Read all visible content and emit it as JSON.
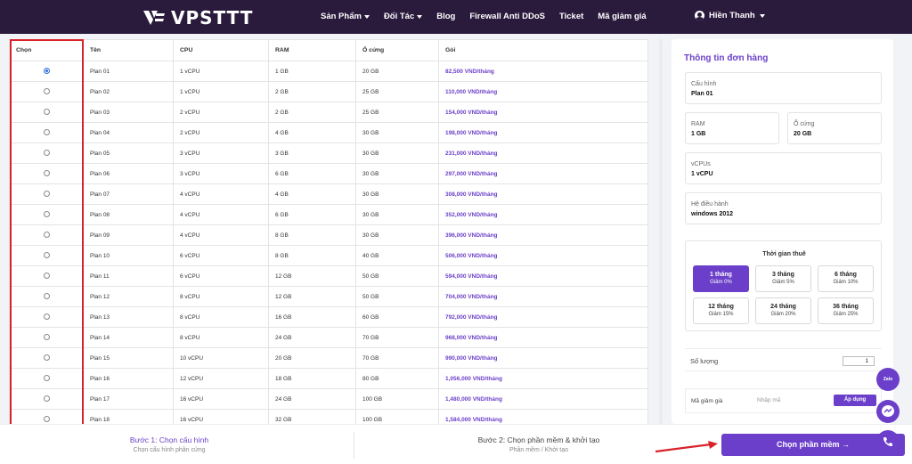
{
  "brand": {
    "name": "VPSTTT"
  },
  "nav": {
    "items": [
      {
        "label": "Sản Phẩm",
        "dropdown": true
      },
      {
        "label": "Đối Tác",
        "dropdown": true
      },
      {
        "label": "Blog",
        "dropdown": false
      },
      {
        "label": "Firewall Anti DDoS",
        "dropdown": false
      },
      {
        "label": "Ticket",
        "dropdown": false
      },
      {
        "label": "Mã giảm giá",
        "dropdown": false
      }
    ],
    "user": "Hiền Thanh"
  },
  "table": {
    "headers": [
      "Chọn",
      "Tên",
      "CPU",
      "RAM",
      "Ổ cứng",
      "Gói"
    ],
    "selected_index": 0,
    "rows": [
      {
        "name": "Plan 01",
        "cpu": "1 vCPU",
        "ram": "1 GB",
        "disk": "20 GB",
        "price": "82,500 VND/tháng"
      },
      {
        "name": "Plan 02",
        "cpu": "1 vCPU",
        "ram": "2 GB",
        "disk": "25 GB",
        "price": "110,000 VND/tháng"
      },
      {
        "name": "Plan 03",
        "cpu": "2 vCPU",
        "ram": "2 GB",
        "disk": "25 GB",
        "price": "154,000 VND/tháng"
      },
      {
        "name": "Plan 04",
        "cpu": "2 vCPU",
        "ram": "4 GB",
        "disk": "30 GB",
        "price": "198,000 VND/tháng"
      },
      {
        "name": "Plan 05",
        "cpu": "3 vCPU",
        "ram": "3 GB",
        "disk": "30 GB",
        "price": "231,000 VND/tháng"
      },
      {
        "name": "Plan 06",
        "cpu": "3 vCPU",
        "ram": "6 GB",
        "disk": "30 GB",
        "price": "297,000 VND/tháng"
      },
      {
        "name": "Plan 07",
        "cpu": "4 vCPU",
        "ram": "4 GB",
        "disk": "30 GB",
        "price": "308,000 VND/tháng"
      },
      {
        "name": "Plan 08",
        "cpu": "4 vCPU",
        "ram": "6 GB",
        "disk": "30 GB",
        "price": "352,000 VND/tháng"
      },
      {
        "name": "Plan 09",
        "cpu": "4 vCPU",
        "ram": "8 GB",
        "disk": "30 GB",
        "price": "396,000 VND/tháng"
      },
      {
        "name": "Plan 10",
        "cpu": "6 vCPU",
        "ram": "8 GB",
        "disk": "40 GB",
        "price": "506,000 VND/tháng"
      },
      {
        "name": "Plan 11",
        "cpu": "6 vCPU",
        "ram": "12 GB",
        "disk": "50 GB",
        "price": "594,000 VND/tháng"
      },
      {
        "name": "Plan 12",
        "cpu": "8 vCPU",
        "ram": "12 GB",
        "disk": "50 GB",
        "price": "704,000 VND/tháng"
      },
      {
        "name": "Plan 13",
        "cpu": "8 vCPU",
        "ram": "16 GB",
        "disk": "60 GB",
        "price": "792,000 VND/tháng"
      },
      {
        "name": "Plan 14",
        "cpu": "8 vCPU",
        "ram": "24 GB",
        "disk": "70 GB",
        "price": "968,000 VND/tháng"
      },
      {
        "name": "Plan 15",
        "cpu": "10 vCPU",
        "ram": "20 GB",
        "disk": "70 GB",
        "price": "990,000 VND/tháng"
      },
      {
        "name": "Plan 16",
        "cpu": "12 vCPU",
        "ram": "18 GB",
        "disk": "80 GB",
        "price": "1,056,000 VND/tháng"
      },
      {
        "name": "Plan 17",
        "cpu": "16 vCPU",
        "ram": "24 GB",
        "disk": "100 GB",
        "price": "1,480,000 VND/tháng"
      },
      {
        "name": "Plan 18",
        "cpu": "16 vCPU",
        "ram": "32 GB",
        "disk": "100 GB",
        "price": "1,584,000 VND/tháng"
      }
    ]
  },
  "order": {
    "title": "Thông tin đơn hàng",
    "config_label": "Cấu hình",
    "config_value": "Plan 01",
    "ram_label": "RAM",
    "ram_value": "1 GB",
    "disk_label": "Ổ cứng",
    "disk_value": "20 GB",
    "cpu_label": "vCPUs",
    "cpu_value": "1 vCPU",
    "os_label": "Hệ điều hành",
    "os_value": "windows 2012",
    "period_title": "Thời gian thuê",
    "periods": [
      {
        "label": "1 tháng",
        "discount": "Giảm 0%",
        "active": true
      },
      {
        "label": "3 tháng",
        "discount": "Giảm 5%",
        "active": false
      },
      {
        "label": "6 tháng",
        "discount": "Giảm 10%",
        "active": false
      },
      {
        "label": "12 tháng",
        "discount": "Giảm 15%",
        "active": false
      },
      {
        "label": "24 tháng",
        "discount": "Giảm 20%",
        "active": false
      },
      {
        "label": "36 tháng",
        "discount": "Giảm 25%",
        "active": false
      }
    ],
    "qty_label": "Số lượng",
    "qty_value": "1",
    "coupon_label": "Mã giảm giá",
    "coupon_placeholder": "Nhập mã",
    "coupon_button": "Áp dụng"
  },
  "steps": {
    "step1_title": "Bước 1: Chọn cấu hình",
    "step1_sub": "Chọn cấu hình phần cứng",
    "step2_title": "Bước 2: Chọn phần mềm & khởi tạo",
    "step2_sub": "Phần mềm / Khởi tạo",
    "cta_label": "Chọn phần mềm →"
  },
  "floating": {
    "zalo_label": "Zalo",
    "icons": [
      "zalo-icon",
      "messenger-icon",
      "phone-icon"
    ]
  },
  "colors": {
    "accent": "#6b3fc9",
    "nav_bg": "#2a1b3d",
    "highlight": "#d8232a"
  }
}
